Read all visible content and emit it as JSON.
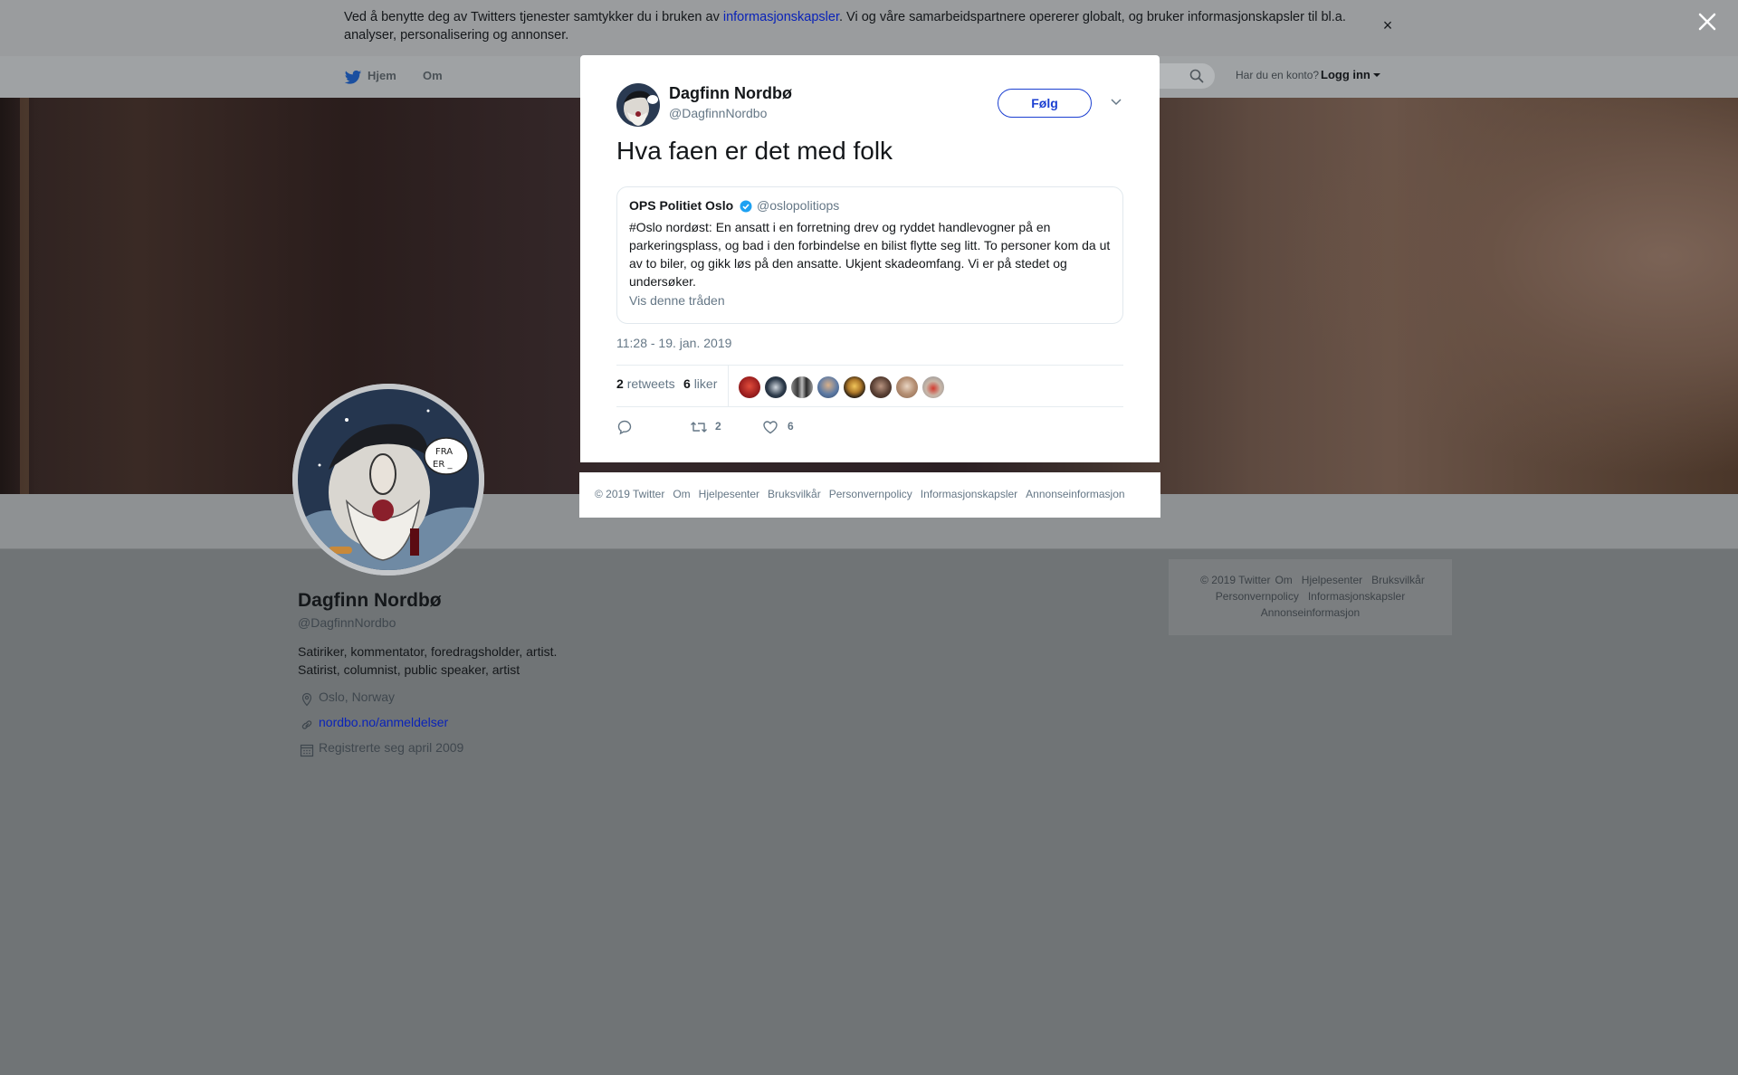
{
  "cookie_bar": {
    "text_before": "Ved å benytte deg av Twitters tjenester samtykker du i bruken av ",
    "link": "informasjonskapsler",
    "text_after": ". Vi og våre samarbeidspartnere opererer globalt, og bruker informasjonskapsler til bl.a. analyser, personalisering og annonser.",
    "close": "×"
  },
  "nav": {
    "home": "Hjem",
    "about": "Om",
    "account_prompt": "Har du en konto?",
    "login": "Logg inn"
  },
  "profile": {
    "name": "Dagfinn Nordbø",
    "handle": "@DagfinnNordbo",
    "bio": "Satiriker, kommentator, foredragsholder, artist. Satirist, columnist, public speaker, artist",
    "location": "Oslo, Norway",
    "website": "nordbo.no/anmeldelser",
    "joined": "Registrerte seg april 2009"
  },
  "side_footer": {
    "line1": [
      "© 2019 Twitter",
      "Om",
      "Hjelpesenter",
      "Bruksvilkår"
    ],
    "line2": [
      "Personvernpolicy",
      "Informasjonskapsler"
    ],
    "line3": [
      "Annonseinformasjon"
    ]
  },
  "tweet": {
    "author_name": "Dagfinn Nordbø",
    "author_handle": "@DagfinnNordbo",
    "follow_label": "Følg",
    "text": "Hva faen er det med folk",
    "quote": {
      "name": "OPS Politiet Oslo",
      "handle": "@oslopolitiops",
      "body": "#Oslo nordøst: En ansatt i en forretning drev og ryddet handlevogner på en parkeringsplass, og bad i den forbindelse en bilist flytte seg litt. To personer kom da ut av to biler, og gikk løs på den ansatte. Ukjent skadeomfang. Vi er på stedet og undersøker.",
      "thread_link": "Vis denne tråden"
    },
    "timestamp": "11:28 - 19. jan. 2019",
    "retweets_count": "2",
    "retweets_label": "retweets",
    "likes_count": "6",
    "likes_label": "liker",
    "action_retweets": "2",
    "action_likes": "6"
  },
  "modal_footer": [
    "© 2019 Twitter",
    "Om",
    "Hjelpesenter",
    "Bruksvilkår",
    "Personvernpolicy",
    "Informasjonskapsler",
    "Annonseinformasjon"
  ],
  "icons": {
    "close_overlay": "close-icon",
    "bird": "twitter-bird-icon",
    "search": "search-icon",
    "location": "location-pin-icon",
    "link": "link-icon",
    "calendar": "calendar-icon",
    "verified": "verified-badge-icon",
    "reply": "reply-icon",
    "retweet": "retweet-icon",
    "like": "heart-icon"
  },
  "colors": {
    "accent": "#1b3fd1",
    "link": "#0a23b8",
    "verified": "#1da1f2",
    "overlay_bg": "#707476"
  }
}
